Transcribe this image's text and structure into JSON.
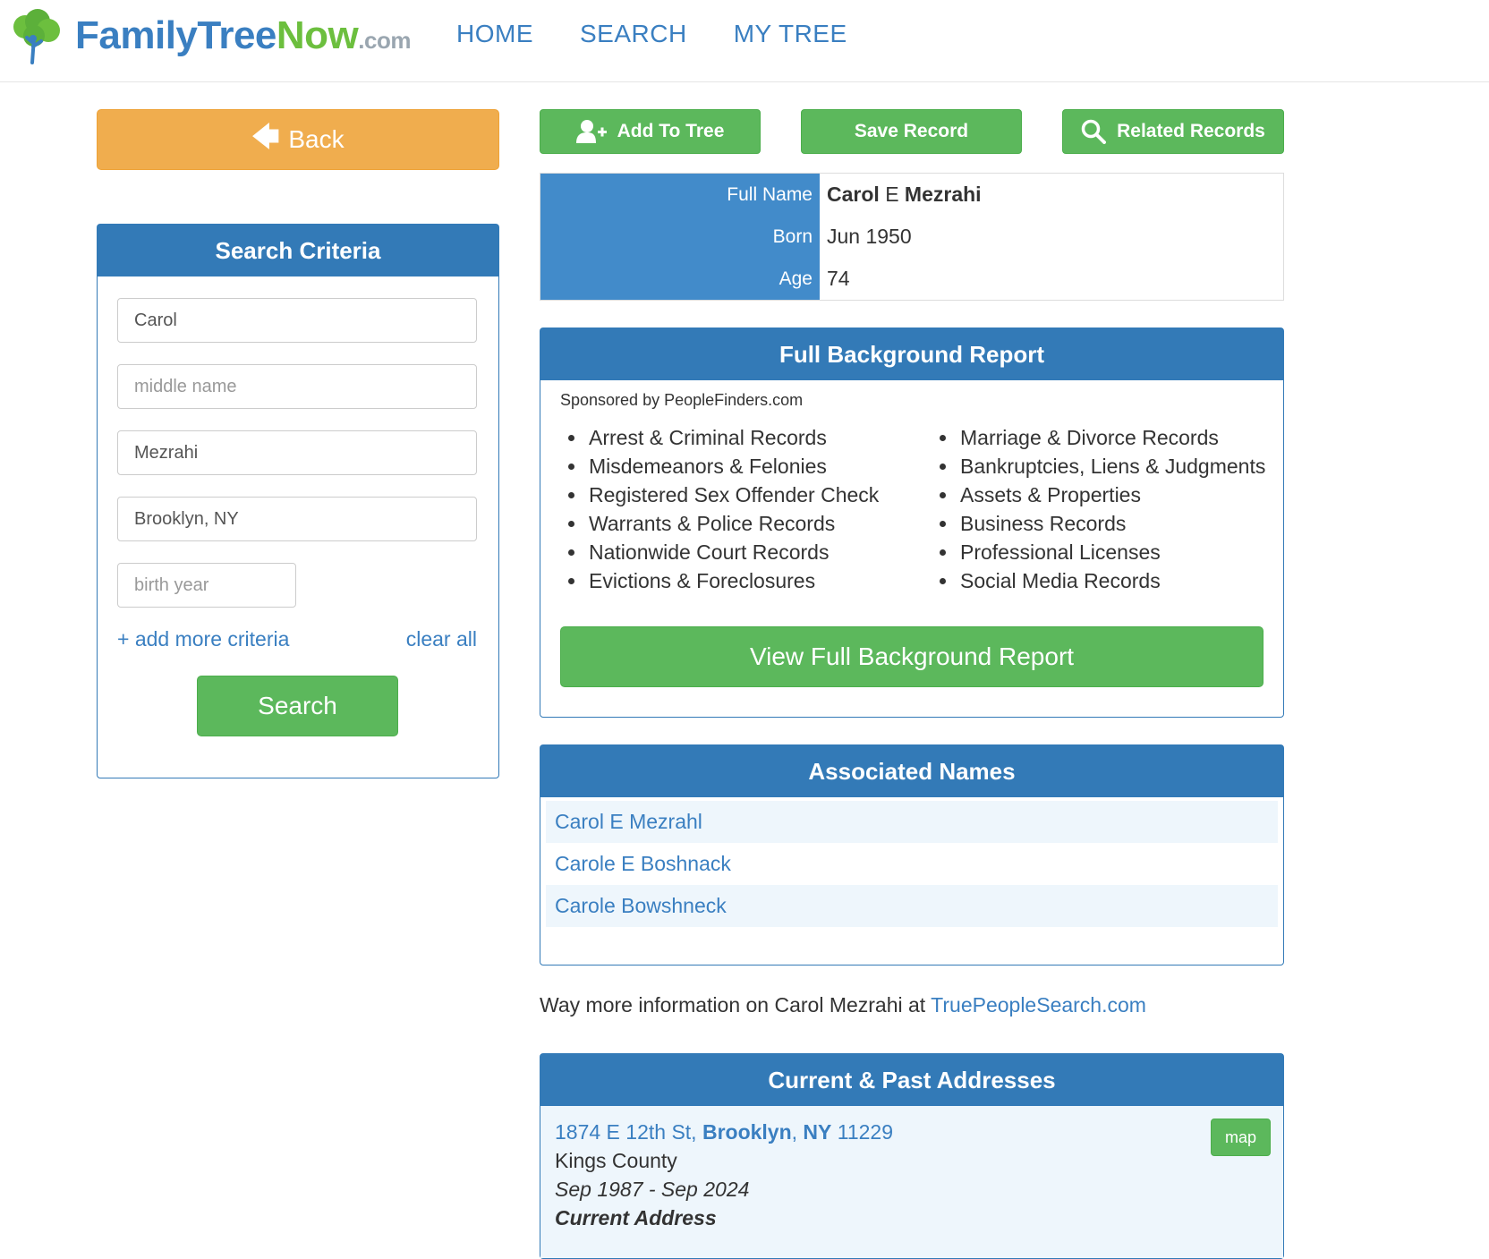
{
  "header": {
    "logo_family": "Family",
    "logo_tree": "Tree",
    "logo_now": "Now",
    "logo_dotcom": ".com",
    "nav": [
      "HOME",
      "SEARCH",
      "MY TREE"
    ]
  },
  "back_label": "Back",
  "search": {
    "title": "Search Criteria",
    "first_name": "Carol",
    "middle_placeholder": "middle name",
    "last_name": "Mezrahi",
    "location": "Brooklyn, NY",
    "birth_placeholder": "birth year",
    "add_more": "+ add more criteria",
    "clear_all": "clear all",
    "button": "Search"
  },
  "actions": {
    "add_to_tree": "Add To Tree",
    "save_record": "Save Record",
    "related_records": "Related Records"
  },
  "person": {
    "labels": [
      "Full Name",
      "Born",
      "Age"
    ],
    "first": "Carol",
    "middle": "E",
    "last": "Mezrahi",
    "born": "Jun 1950",
    "age": "74"
  },
  "background": {
    "title": "Full Background Report",
    "sponsored": "Sponsored by PeopleFinders.com",
    "left_items": [
      "Arrest & Criminal Records",
      "Misdemeanors & Felonies",
      "Registered Sex Offender Check",
      "Warrants & Police Records",
      "Nationwide Court Records",
      "Evictions & Foreclosures"
    ],
    "right_items": [
      "Marriage & Divorce Records",
      "Bankruptcies, Liens & Judgments",
      "Assets & Properties",
      "Business Records",
      "Professional Licenses",
      "Social Media Records"
    ],
    "button": "View Full Background Report"
  },
  "associated": {
    "title": "Associated Names",
    "names": [
      "Carol E Mezrahl",
      "Carole E Boshnack",
      "Carole Bowshneck"
    ]
  },
  "more_info": {
    "text": "Way more information on Carol Mezrahi at ",
    "link": "TruePeopleSearch.com"
  },
  "addresses": {
    "title": "Current & Past Addresses",
    "street": "1874 E 12th St, ",
    "city": "Brooklyn",
    "state": "NY",
    "zip": " 11229",
    "county": "Kings County",
    "dates": "Sep 1987 - Sep 2024",
    "status": "Current Address",
    "map": "map"
  },
  "colors": {
    "primary": "#337ab7",
    "link": "#3a7fc1",
    "success": "#5cb85c",
    "warning": "#f0ad4e"
  }
}
